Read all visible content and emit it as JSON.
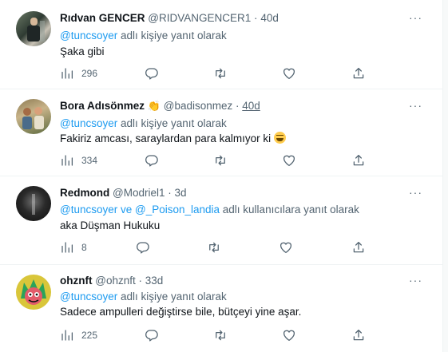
{
  "tweets": [
    {
      "name": "Rıdvan GENCER",
      "handle": "@RIDVANGENCER1",
      "sep": "·",
      "time": "40d",
      "reply_link": "@tuncsoyer",
      "reply_suffix": " adlı kişiye yanıt olarak",
      "text": "Şaka gibi",
      "views": "296",
      "more": "···"
    },
    {
      "name": "Bora Adısönmez",
      "handle": "@badisonmez",
      "sep": "·",
      "time": "40d",
      "name_emoji": "👏",
      "reply_link": "@tuncsoyer",
      "reply_suffix": " adlı kişiye yanıt olarak",
      "text": "Fakiriz amcası, saraylardan para kalmıyor ki",
      "text_emoji": "🤣",
      "views": "334",
      "more": "···"
    },
    {
      "name": "Redmond",
      "handle": "@Modriel1",
      "sep": "·",
      "time": "3d",
      "reply_link": "@tuncsoyer ve @_Poison_landia",
      "reply_suffix": " adlı kullanıcılara yanıt olarak",
      "text": "aka Düşman Hukuku",
      "views": "8",
      "more": "···"
    },
    {
      "name": "ohznft",
      "handle": "@ohznft",
      "sep": "·",
      "time": "33d",
      "reply_link": "@tuncsoyer",
      "reply_suffix": " adlı kişiye yanıt olarak",
      "text": "Sadece ampulleri değiştirse bile, bütçeyi yine aşar.",
      "views": "225",
      "more": "···"
    }
  ],
  "colors": {
    "link": "#1d9bf0",
    "muted": "#536471",
    "text": "#0f1419"
  }
}
